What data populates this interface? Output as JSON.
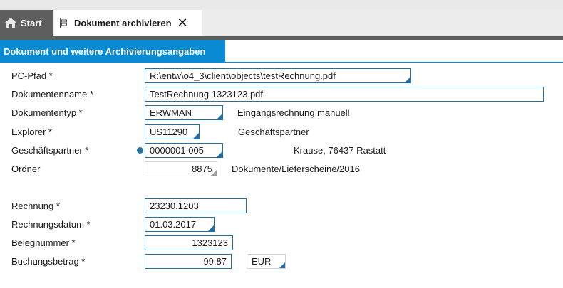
{
  "tabs": {
    "start_label": "Start",
    "active_label": "Dokument archivieren"
  },
  "section": {
    "title": "Dokument und weitere Archivierungsangaben"
  },
  "form": {
    "pc_pfad": {
      "label": "PC-Pfad *",
      "value": "R:\\entw\\o4_3\\client\\objects\\testRechnung.pdf"
    },
    "dokumentenname": {
      "label": "Dokumentenname *",
      "value": "TestRechnung 1323123.pdf"
    },
    "dokumententyp": {
      "label": "Dokumententyp *",
      "value": "ERWMAN",
      "description": "Eingangsrechnung manuell"
    },
    "explorer": {
      "label": "Explorer *",
      "value": "US11290",
      "description": "Geschäftspartner"
    },
    "geschaeftspartner": {
      "label": "Geschäftspartner *",
      "value": "0000001 005",
      "description": "Krause, 76437 Rastatt"
    },
    "ordner": {
      "label": "Ordner",
      "value": "8875",
      "description": "Dokumente/Lieferscheine/2016"
    },
    "rechnung": {
      "label": "Rechnung *",
      "value": "23230.1203"
    },
    "rechnungsdatum": {
      "label": "Rechnungsdatum *",
      "value": "01.03.2017"
    },
    "belegnummer": {
      "label": "Belegnummer *",
      "value": "1323123"
    },
    "buchungsbetrag": {
      "label": "Buchungsbetrag *",
      "value": "99,87",
      "currency": "EUR"
    }
  },
  "colors": {
    "accent": "#0a8ad2",
    "field_border": "#1f6fa8",
    "tab_dark": "#5e5e5e"
  },
  "icons": {
    "start": "home-icon",
    "active_tab": "document-icon",
    "close": "close-icon",
    "info": "info-icon"
  }
}
